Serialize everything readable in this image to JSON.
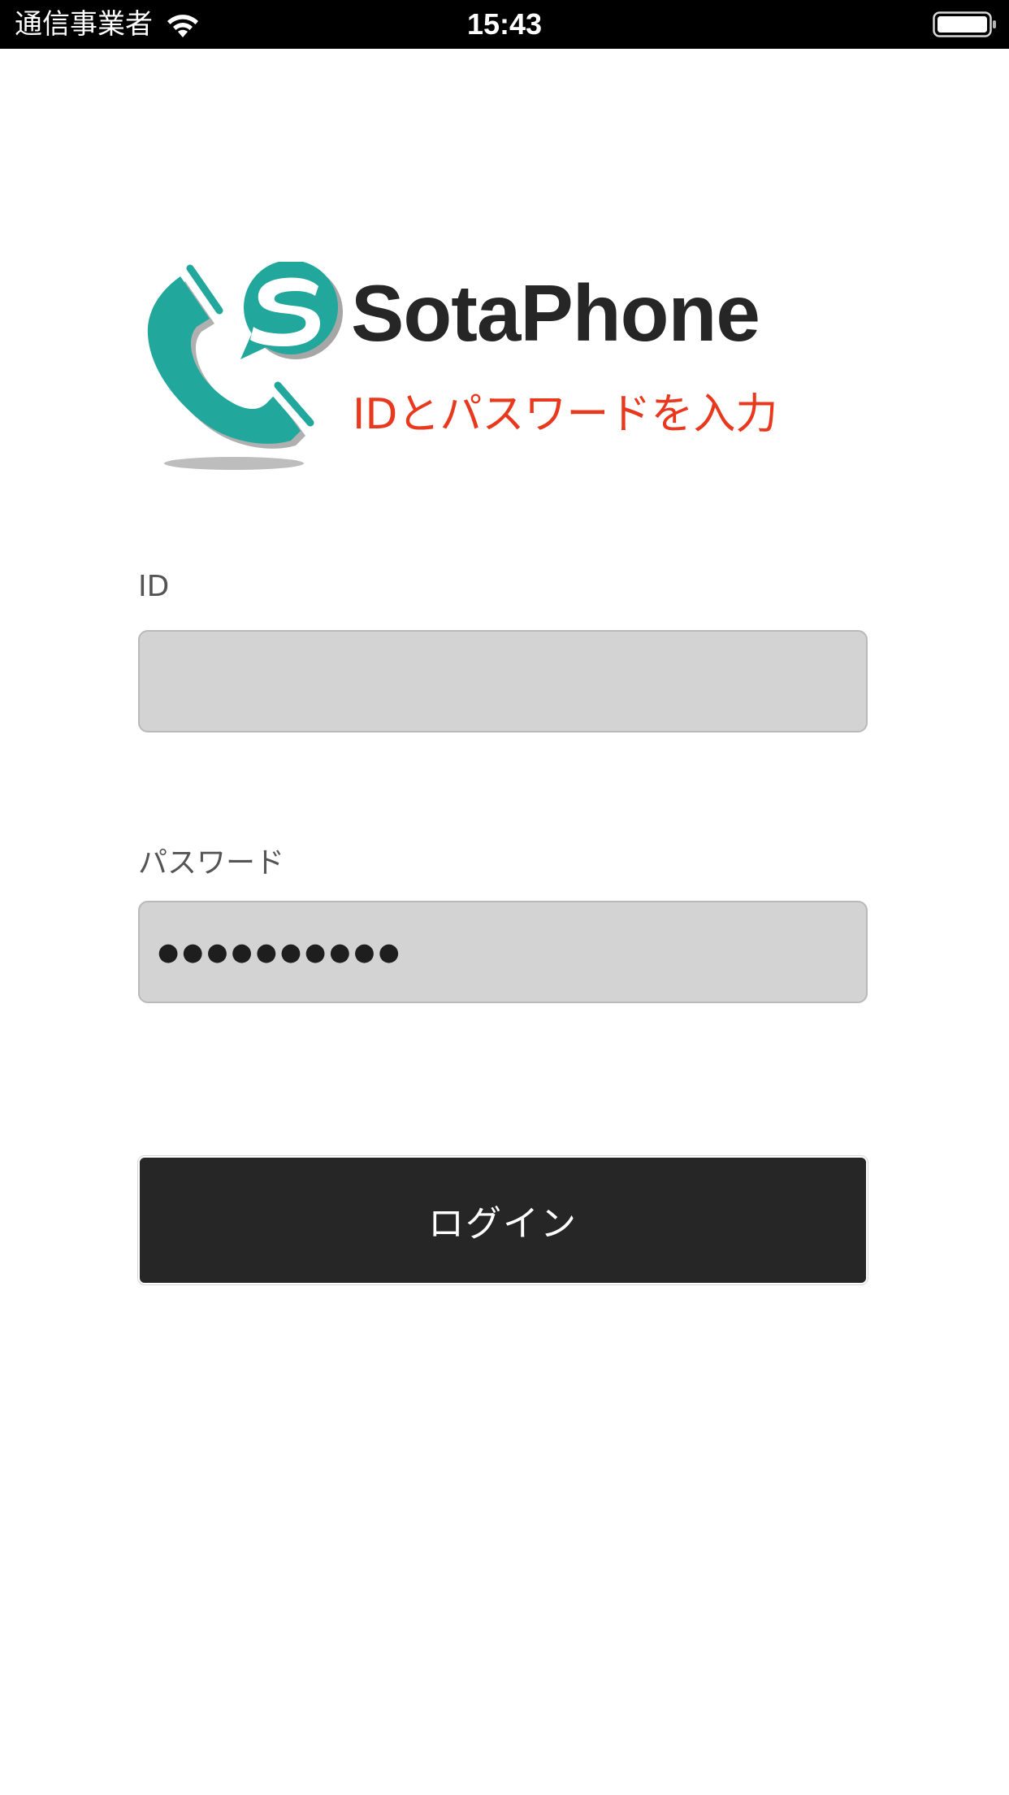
{
  "status_bar": {
    "carrier": "通信事業者",
    "time": "15:43",
    "wifi_icon": "wifi-icon",
    "battery_icon": "battery-full-icon"
  },
  "brand": {
    "name": "SotaPhone",
    "subtitle": "IDとパスワードを入力",
    "logo_icon": "sotaphone-logo-icon",
    "accent_color": "#22a79c",
    "subtitle_color": "#e8381e"
  },
  "form": {
    "id_label": "ID",
    "id_value": "",
    "password_label": "パスワード",
    "password_value": "●●●●●●●●●●",
    "login_label": "ログイン"
  }
}
